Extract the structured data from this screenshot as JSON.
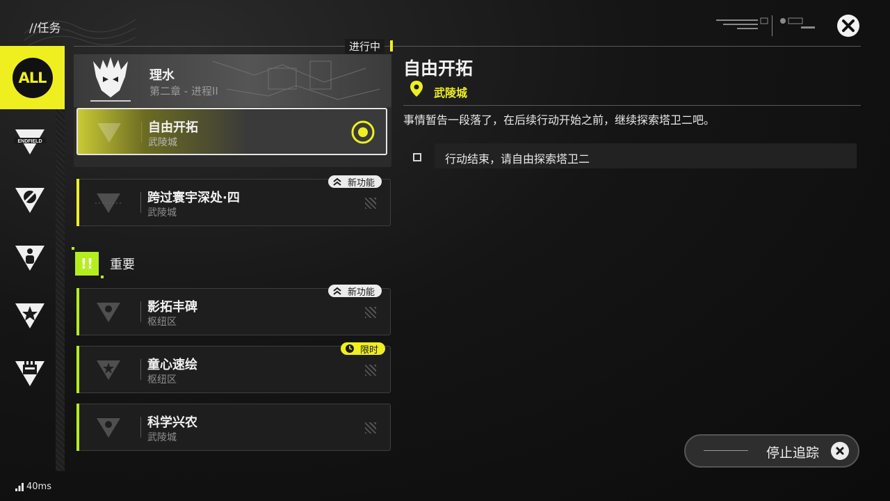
{
  "header": {
    "title": "//任务",
    "close_icon": "close-icon"
  },
  "sidebar": {
    "all_label": "ALL",
    "items": [
      {
        "icon": "endfield-category-icon",
        "label": "ENDFIELD"
      },
      {
        "icon": "pen-category-icon"
      },
      {
        "icon": "person-category-icon"
      },
      {
        "icon": "star-category-icon"
      },
      {
        "icon": "box-category-icon"
      }
    ]
  },
  "list": {
    "in_progress_label": "进行中",
    "group": {
      "title": "理水",
      "subtitle": "第二章 - 进程II"
    },
    "quests": [
      {
        "name": "自由开拓",
        "location": "武陵城",
        "selected": true
      },
      {
        "name": "跨过寰宇深处·四",
        "location": "武陵城",
        "badge": "新功能"
      }
    ],
    "section_important": {
      "icon_text": "!!",
      "title": "重要"
    },
    "important_quests": [
      {
        "name": "影拓丰碑",
        "location": "枢纽区",
        "badge": "新功能"
      },
      {
        "name": "童心速绘",
        "location": "枢纽区",
        "badge": "限时"
      },
      {
        "name": "科学兴农",
        "location": "武陵城"
      }
    ]
  },
  "detail": {
    "title": "自由开拓",
    "location": "武陵城",
    "description": "事情暂告一段落了，在后续行动开始之前，继续探索塔卫二吧。",
    "objective": "行动结束，请自由探索塔卫二"
  },
  "stop_tracking": {
    "label": "停止追踪"
  },
  "network": {
    "ping": "40ms"
  },
  "colors": {
    "accent": "#efef1f",
    "important": "#b5ee1e"
  }
}
